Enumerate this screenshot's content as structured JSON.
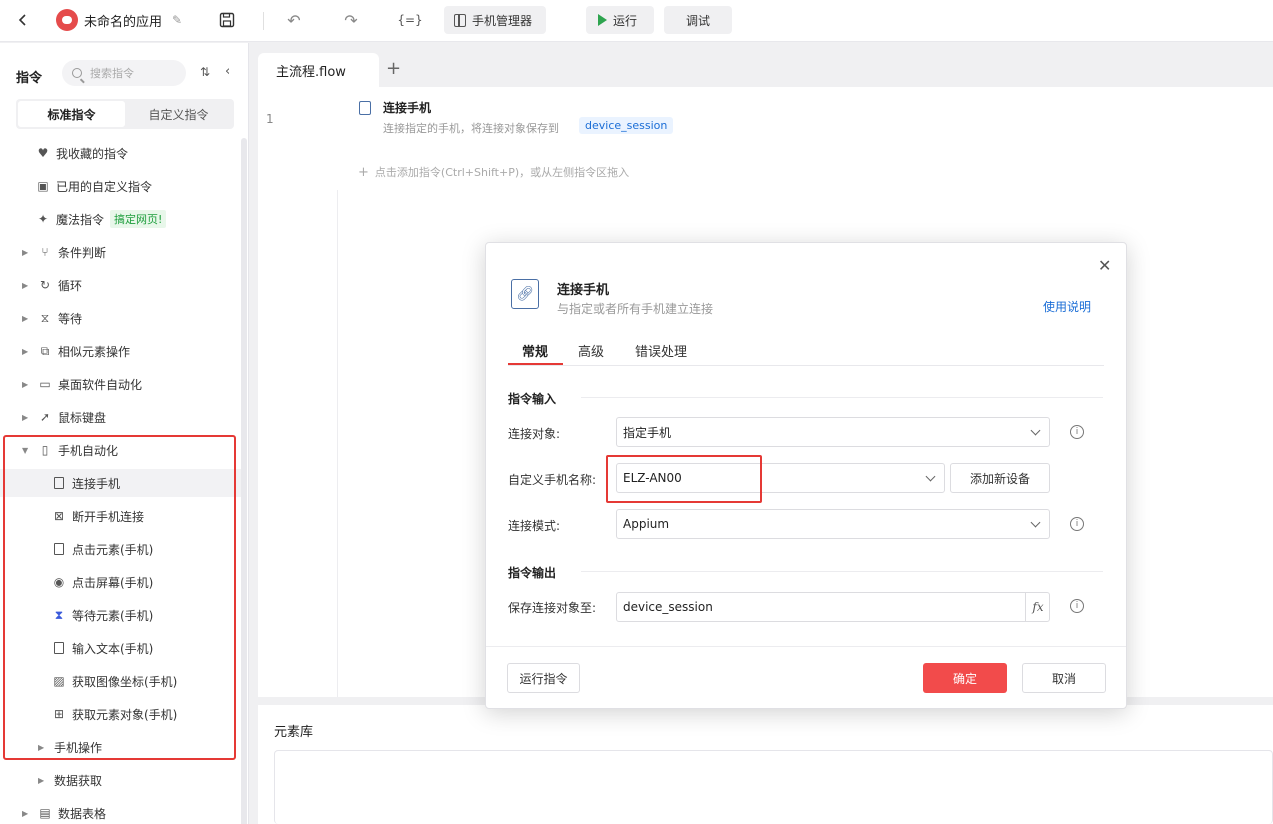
{
  "app": {
    "title": "未命名的应用"
  },
  "toolbar": {
    "var_label": "{=}",
    "phone_manager_label": "手机管理器",
    "run_label": "运行",
    "debug_label": "调试"
  },
  "sidebar": {
    "title": "指令",
    "search_placeholder": "搜索指令",
    "segments": [
      "标准指令",
      "自定义指令"
    ],
    "items": [
      {
        "label": "我收藏的指令"
      },
      {
        "label": "已用的自定义指令"
      },
      {
        "label": "魔法指令",
        "badge": "搞定网页!"
      },
      {
        "label": "条件判断"
      },
      {
        "label": "循环"
      },
      {
        "label": "等待"
      },
      {
        "label": "相似元素操作"
      },
      {
        "label": "桌面软件自动化"
      },
      {
        "label": "鼠标键盘"
      },
      {
        "label": "手机自动化"
      },
      {
        "label": "连接手机"
      },
      {
        "label": "断开手机连接"
      },
      {
        "label": "点击元素(手机)"
      },
      {
        "label": "点击屏幕(手机)"
      },
      {
        "label": "等待元素(手机)"
      },
      {
        "label": "输入文本(手机)"
      },
      {
        "label": "获取图像坐标(手机)"
      },
      {
        "label": "获取元素对象(手机)"
      },
      {
        "label": "手机操作"
      },
      {
        "label": "数据获取"
      },
      {
        "label": "数据表格"
      }
    ]
  },
  "editor": {
    "tab_label": "主流程.flow",
    "line_number": "1",
    "step": {
      "title": "连接手机",
      "desc": "连接指定的手机，将连接对象保存到",
      "var": "device_session"
    },
    "add_hint": "点击添加指令(Ctrl+Shift+P)，或从左侧指令区拖入"
  },
  "bottom": {
    "title": "元素库"
  },
  "dialog": {
    "title": "连接手机",
    "subtitle": "与指定或者所有手机建立连接",
    "help": "使用说明",
    "tabs": [
      "常规",
      "高级",
      "错误处理"
    ],
    "input_section": "指令输入",
    "output_section": "指令输出",
    "fields": {
      "target_label": "连接对象:",
      "target_value": "指定手机",
      "name_label": "自定义手机名称:",
      "name_value": "ELZ-AN00",
      "add_device": "添加新设备",
      "mode_label": "连接模式:",
      "mode_value": "Appium",
      "save_label": "保存连接对象至:",
      "save_value": "device_session",
      "fx": "fx"
    },
    "run_cmd": "运行指令",
    "ok": "确定",
    "cancel": "取消"
  },
  "colors": {
    "primary": "#f24b4b",
    "highlight": "#e53935",
    "link": "#1a6dd6",
    "badge_green": "#1e9e3d"
  }
}
